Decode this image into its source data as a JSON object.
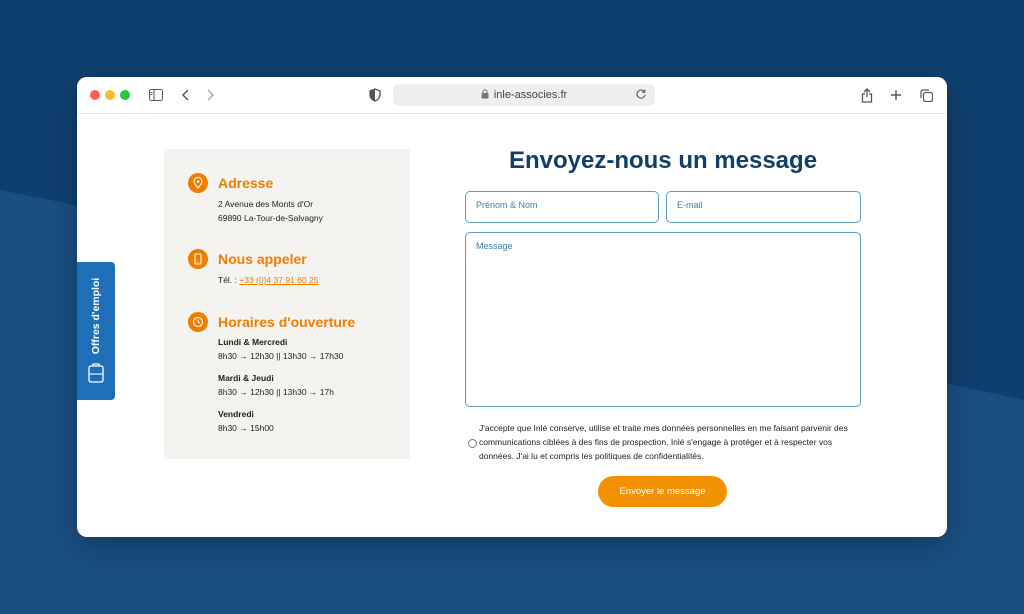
{
  "browser": {
    "url": "inle-associes.fr"
  },
  "side_tab": {
    "label": "Offres d'emploi"
  },
  "contact_info": {
    "address": {
      "title": "Adresse",
      "line1": "2 Avenue des Monts d'Or",
      "line2": "69890 La-Tour-de-Salvagny"
    },
    "phone": {
      "title": "Nous appeler",
      "prefix": "Tél. : ",
      "number": "+33 (0)4 37 91 60 25"
    },
    "hours": {
      "title": "Horaires d'ouverture",
      "blocks": [
        {
          "days": "Lundi & Mercredi",
          "times": "8h30 → 12h30  ||  13h30 → 17h30"
        },
        {
          "days": "Mardi & Jeudi",
          "times": "8h30 → 12h30 || 13h30 → 17h"
        },
        {
          "days": "Vendredi",
          "times": "8h30 → 15h00"
        }
      ]
    }
  },
  "form": {
    "title": "Envoyez-nous un message",
    "name_placeholder": "Prénom & Nom",
    "email_placeholder": "E-mail",
    "message_placeholder": "Message",
    "consent_text": "J'accepte que Inlé conserve, utilise et traite mes données personnelles en me faisant parvenir des communications ciblées à des fins de prospection. Inlé s'engage à protéger et à respecter vos données. J'ai lu et compris les politiques de confidentialités.",
    "submit_label": "Envoyer le message"
  },
  "colors": {
    "background": "#0f3f6e",
    "accent_orange": "#ef7d00",
    "title_blue": "#123e6a",
    "side_tab_blue": "#1f6fb8"
  }
}
